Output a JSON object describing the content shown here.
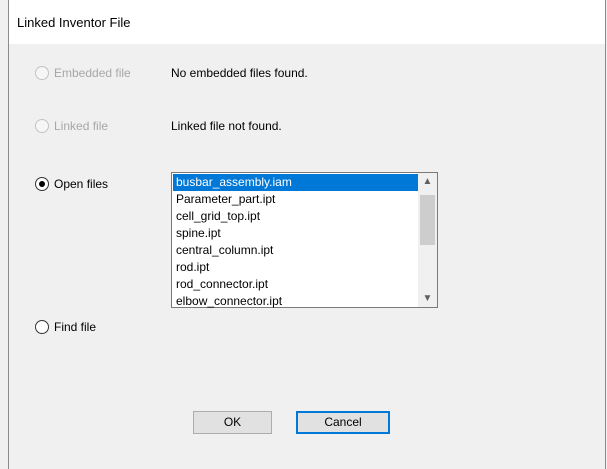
{
  "window": {
    "title": "Linked Inventor File"
  },
  "options": {
    "embedded": {
      "label": "Embedded file",
      "info": "No embedded files found."
    },
    "linked": {
      "label": "Linked file",
      "info": "Linked file not found."
    },
    "open": {
      "label": "Open files"
    },
    "find": {
      "label": "Find file"
    }
  },
  "files": [
    "busbar_assembly.iam",
    "Parameter_part.ipt",
    "cell_grid_top.ipt",
    "spine.ipt",
    "central_column.ipt",
    "rod.ipt",
    "rod_connector.ipt",
    "elbow_connector.ipt"
  ],
  "selected_file": "busbar_assembly.iam",
  "buttons": {
    "ok": "OK",
    "cancel": "Cancel"
  },
  "colors": {
    "selection": "#0078d7",
    "default_button_border": "#0078d7"
  }
}
